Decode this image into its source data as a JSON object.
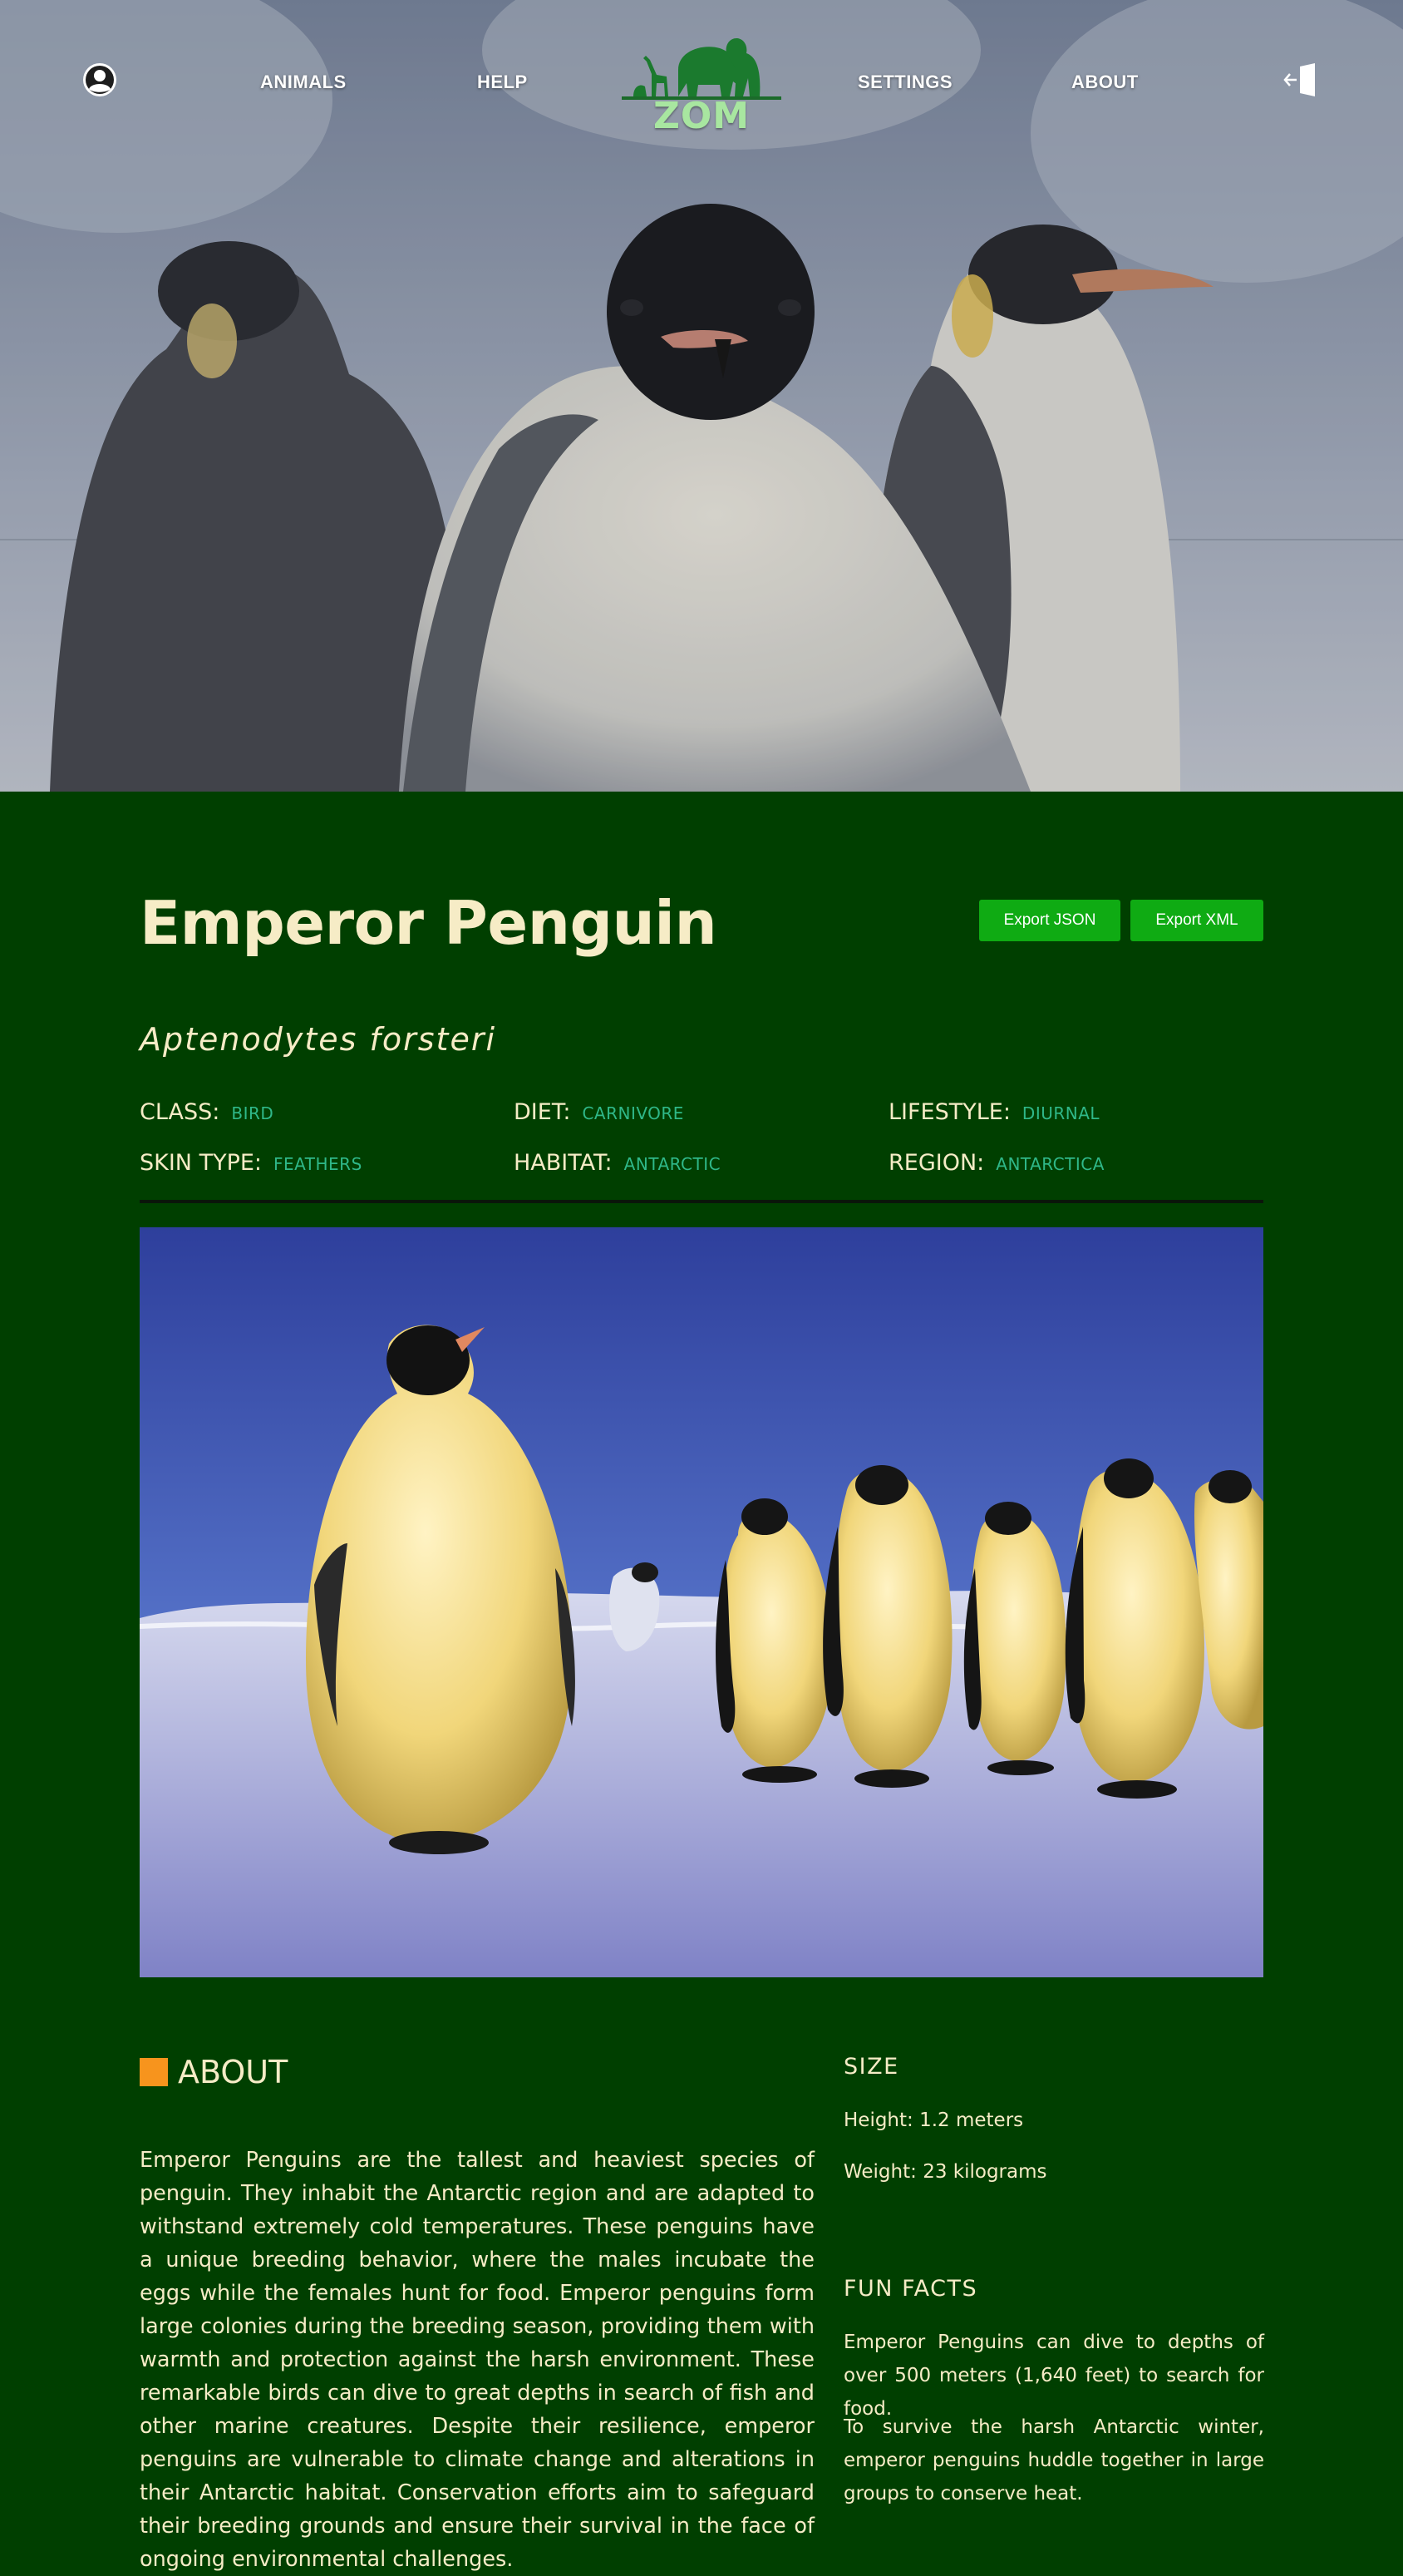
{
  "nav": {
    "animals": "ANIMALS",
    "help": "HELP",
    "settings": "SETTINGS",
    "about": "ABOUT",
    "logo_text": "ZOM",
    "profile_icon": "user-icon",
    "logout_icon": "logout-icon"
  },
  "animal": {
    "name": "Emperor Penguin",
    "scientific_name": "Aptenodytes forsteri",
    "attributes": [
      {
        "key": "CLASS:",
        "value": "BIRD"
      },
      {
        "key": "DIET:",
        "value": "CARNIVORE"
      },
      {
        "key": "LIFESTYLE:",
        "value": "DIURNAL"
      },
      {
        "key": "SKIN TYPE:",
        "value": "FEATHERS"
      },
      {
        "key": "HABITAT:",
        "value": "ANTARCTIC"
      },
      {
        "key": "REGION:",
        "value": "ANTARCTICA"
      }
    ]
  },
  "actions": {
    "export_json": "Export JSON",
    "export_xml": "Export XML"
  },
  "about": {
    "heading": "ABOUT",
    "text": "Emperor Penguins are the tallest and heaviest species of penguin. They inhabit the Antarctic region and are adapted to withstand extremely cold temperatures. These penguins have a unique breeding behavior, where the males incubate the eggs while the females hunt for food. Emperor penguins form large colonies during the breeding season, providing them with warmth and protection against the harsh environment. These remarkable birds can dive to great depths in search of fish and other marine creatures. Despite their resilience, emperor penguins are vulnerable to climate change and alterations in their Antarctic habitat. Conservation efforts aim to safeguard their breeding grounds and ensure their survival in the face of ongoing environmental challenges."
  },
  "size": {
    "heading": "SIZE",
    "height": "Height: 1.2 meters",
    "weight": "Weight: 23 kilograms"
  },
  "fun_facts": {
    "heading": "FUN FACTS",
    "facts": [
      "Emperor Penguins can dive to depths of over 500 meters (1,640 feet) to search for food.",
      "To survive the harsh Antarctic winter, emperor penguins huddle together in large groups to conserve heat."
    ]
  },
  "colors": {
    "background": "#003f00",
    "title": "#f6ecc6",
    "attribute_value": "#2fb889",
    "button": "#0fab13",
    "about_square": "#f7941d"
  }
}
